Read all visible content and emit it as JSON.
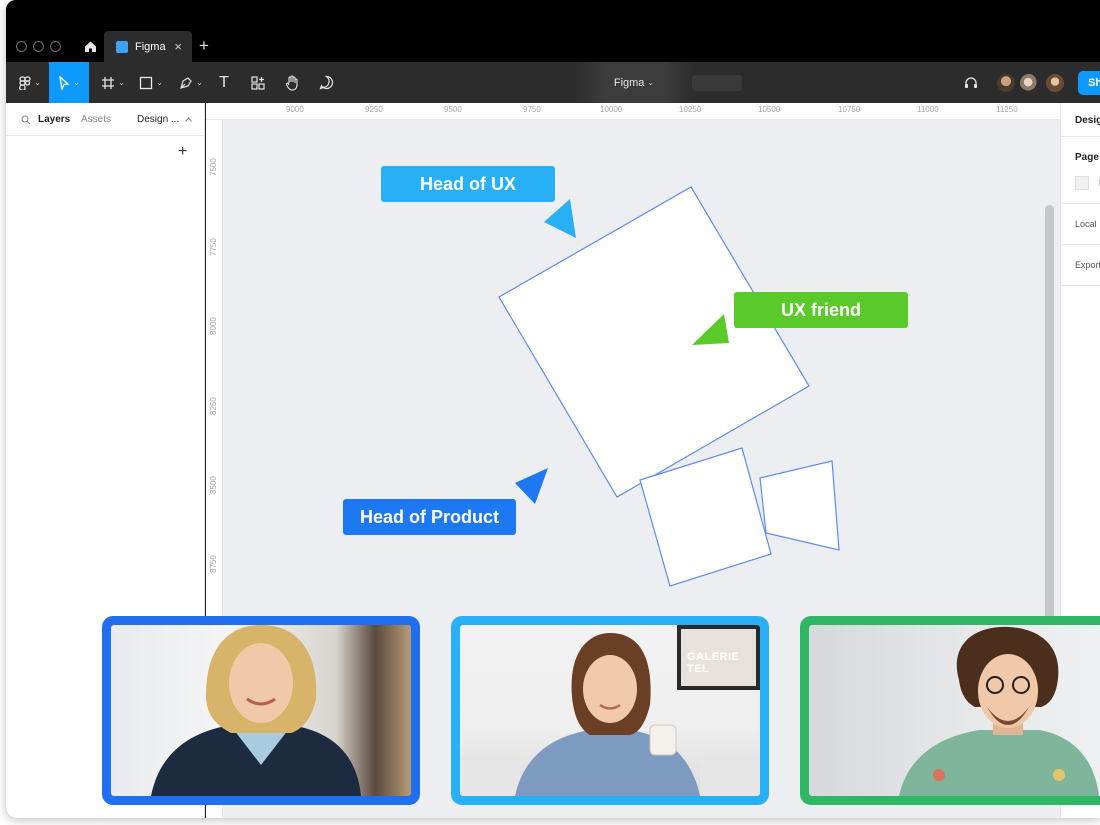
{
  "window": {
    "tab_title": "Figma",
    "close_glyph": "×",
    "new_tab_glyph": "+"
  },
  "toolbar": {
    "doc_title": "Figma",
    "share_label": "Share",
    "icons": [
      "figma-menu-icon",
      "move-tool-icon",
      "frame-tool-icon",
      "shape-tool-icon",
      "pen-tool-icon",
      "text-tool-icon",
      "components-icon",
      "hand-tool-icon",
      "comment-icon",
      "headphones-icon"
    ],
    "text_tool_glyph": "T",
    "caret_glyph": "⌄"
  },
  "left_panel": {
    "tabs": [
      "Layers",
      "Assets",
      "Design ..."
    ],
    "add_glyph": "+"
  },
  "rulers": {
    "horizontal": [
      "9000",
      "9250",
      "9500",
      "9750",
      "10000",
      "10250",
      "10500",
      "10750",
      "11000",
      "11250"
    ],
    "vertical": [
      "7500",
      "7750",
      "8000",
      "8250",
      "8500",
      "8750"
    ]
  },
  "canvas": {
    "labels": [
      {
        "text": "Head of UX",
        "color": "#27b0f5"
      },
      {
        "text": "UX friend",
        "color": "#5ac92a"
      },
      {
        "text": "Head of Product",
        "color": "#1d78f2"
      }
    ]
  },
  "right_panel": {
    "design_label": "Design",
    "page_label": "Page",
    "page_swatch_letter": "E",
    "local_label": "Local",
    "export_label": "Export"
  },
  "video_tiles": [
    {
      "person": "Head of Product",
      "border_color": "#1f6fef"
    },
    {
      "person": "Head of UX",
      "border_color": "#27b0f5",
      "wall_sign": "GALERIE TEL"
    },
    {
      "person": "UX friend",
      "border_color": "#2fb765"
    }
  ]
}
